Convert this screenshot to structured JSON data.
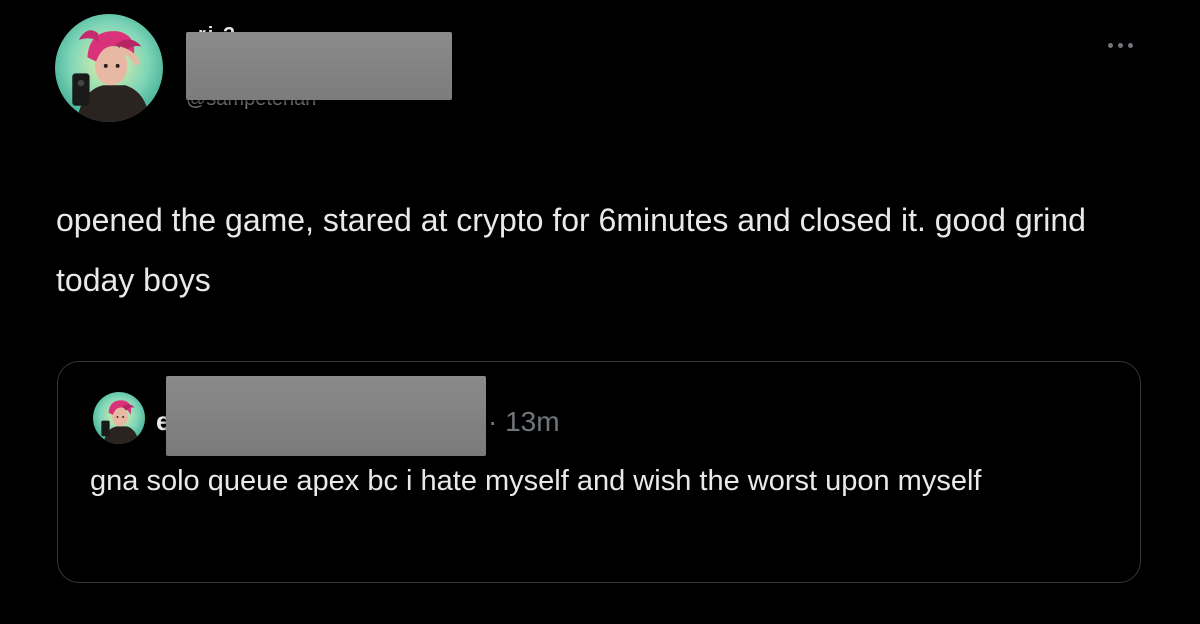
{
  "post": {
    "author": {
      "display_name": "ri ?",
      "handle": "@sampetehan"
    },
    "more_icon": "more-horizontal-icon",
    "text": "opened the game, stared at crypto for 6minutes and closed it. good grind today boys"
  },
  "quoted_post": {
    "author_initial": "e",
    "time": "· 13m",
    "text": "gna solo queue apex bc i hate myself and wish the worst upon myself"
  },
  "colors": {
    "background": "#000000",
    "text_primary": "#e7e9ea",
    "text_secondary": "#71767b",
    "card_border": "#333639",
    "redaction": "#838383"
  }
}
